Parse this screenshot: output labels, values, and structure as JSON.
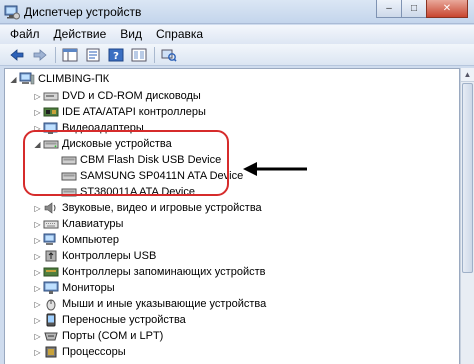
{
  "window": {
    "title": "Диспетчер устройств",
    "icon": "device-manager-icon",
    "buttons": {
      "minimize": "–",
      "maximize": "□",
      "close": "✕"
    }
  },
  "menu": [
    {
      "label": "Файл"
    },
    {
      "label": "Действие"
    },
    {
      "label": "Вид"
    },
    {
      "label": "Справка"
    }
  ],
  "toolbar": {
    "buttons": [
      "back-arrow-icon",
      "forward-arrow-icon",
      "properties-icon",
      "help-icon",
      "console-tree-icon",
      "scan-hardware-icon"
    ]
  },
  "tree": {
    "root": {
      "label": "CLIMBING-ПК",
      "expanded": true
    },
    "items": [
      {
        "label": "DVD и CD-ROM дисководы",
        "icon": "dvd-drive-icon",
        "expanded": false
      },
      {
        "label": "IDE ATA/ATAPI контроллеры",
        "icon": "ide-controller-icon",
        "expanded": false
      },
      {
        "label": "Видеоадаптеры",
        "icon": "display-adapter-icon",
        "expanded": false
      },
      {
        "label": "Дисковые устройства",
        "icon": "disk-drive-icon",
        "expanded": true,
        "children": [
          {
            "label": "CBM Flash Disk USB Device",
            "icon": "disk-icon"
          },
          {
            "label": "SAMSUNG SP0411N ATA Device",
            "icon": "disk-icon"
          },
          {
            "label": "ST380011A ATA Device",
            "icon": "disk-icon"
          }
        ]
      },
      {
        "label": "Звуковые, видео и игровые устройства",
        "icon": "sound-icon",
        "expanded": false
      },
      {
        "label": "Клавиатуры",
        "icon": "keyboard-icon",
        "expanded": false
      },
      {
        "label": "Компьютер",
        "icon": "computer-icon",
        "expanded": false
      },
      {
        "label": "Контроллеры USB",
        "icon": "usb-icon",
        "expanded": false
      },
      {
        "label": "Контроллеры запоминающих устройств",
        "icon": "storage-controller-icon",
        "expanded": false
      },
      {
        "label": "Мониторы",
        "icon": "monitor-icon",
        "expanded": false
      },
      {
        "label": "Мыши и иные указывающие устройства",
        "icon": "mouse-icon",
        "expanded": false
      },
      {
        "label": "Переносные устройства",
        "icon": "portable-device-icon",
        "expanded": false
      },
      {
        "label": "Порты (COM и LPT)",
        "icon": "port-icon",
        "expanded": false
      },
      {
        "label": "Процессоры",
        "icon": "processor-icon",
        "expanded": false
      }
    ]
  },
  "annotation": {
    "highlight_color": "#d62b2b",
    "arrow_color": "#000000"
  }
}
